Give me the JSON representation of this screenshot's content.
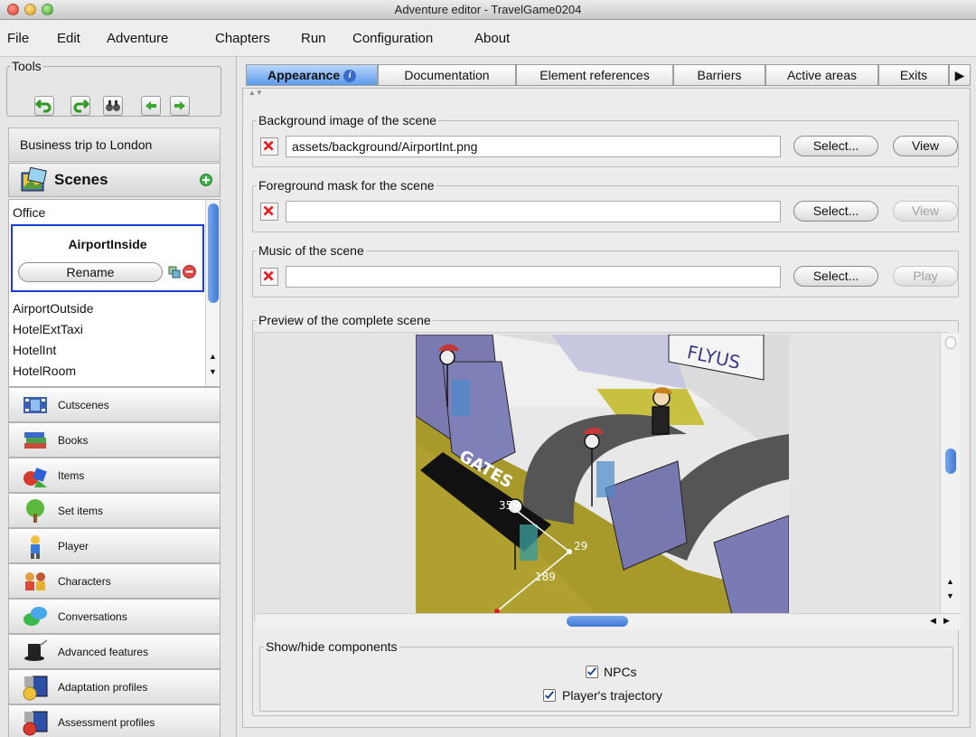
{
  "window": {
    "title": "Adventure editor - TravelGame0204"
  },
  "menu": [
    "File",
    "Edit",
    "Adventure",
    "Chapters",
    "Run",
    "Configuration",
    "About"
  ],
  "tools": {
    "label": "Tools"
  },
  "adventure": {
    "title": "Business trip to London"
  },
  "scenes": {
    "header": "Scenes",
    "items": [
      "Office",
      "AirportOutside",
      "HotelExtTaxi",
      "HotelInt",
      "HotelRoom"
    ],
    "selected": "AirportInside",
    "rename_label": "Rename"
  },
  "categories": [
    "Cutscenes",
    "Books",
    "Items",
    "Set items",
    "Player",
    "Characters",
    "Conversations",
    "Advanced features",
    "Adaptation profiles",
    "Assessment profiles"
  ],
  "tabs": [
    "Appearance",
    "Documentation",
    "Element references",
    "Barriers",
    "Active areas",
    "Exits"
  ],
  "background": {
    "label": "Background image of the scene",
    "value": "assets/background/AirportInt.png",
    "select": "Select...",
    "view": "View"
  },
  "foreground": {
    "label": "Foreground mask for the scene",
    "value": "",
    "select": "Select...",
    "view": "View"
  },
  "music": {
    "label": "Music of the scene",
    "value": "",
    "select": "Select...",
    "play": "Play"
  },
  "preview": {
    "label": "Preview of the complete scene",
    "sign_text": "GATES",
    "banner_text": "FLYUS",
    "trajectory_labels": [
      "359",
      "29",
      "189"
    ]
  },
  "components": {
    "label": "Show/hide components",
    "npcs": {
      "label": "NPCs",
      "checked": true
    },
    "trajectory": {
      "label": "Player's trajectory",
      "checked": true
    }
  }
}
